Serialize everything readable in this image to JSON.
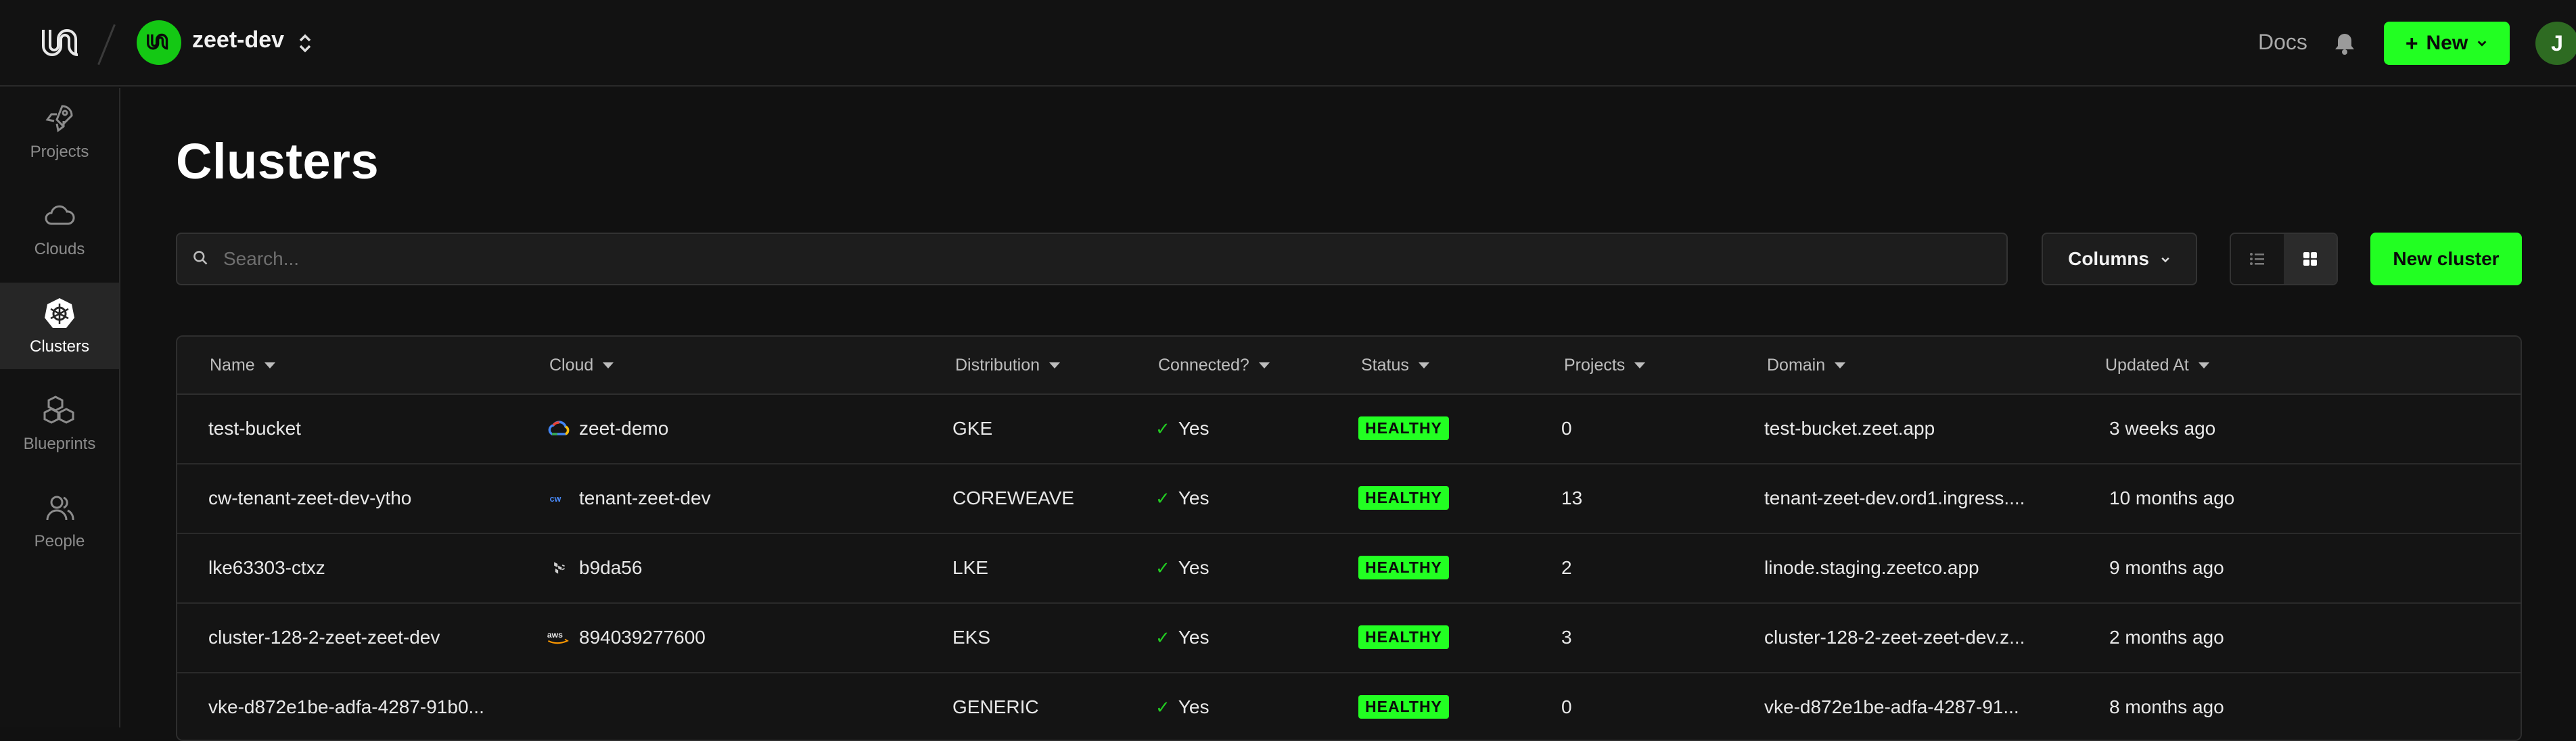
{
  "topbar": {
    "org_name": "zeet-dev",
    "docs_label": "Docs",
    "new_label": "New",
    "user_initial": "J"
  },
  "sidebar": {
    "items": [
      {
        "label": "Projects",
        "icon": "rocket-icon"
      },
      {
        "label": "Clouds",
        "icon": "cloud-icon"
      },
      {
        "label": "Clusters",
        "icon": "kubernetes-icon",
        "active": true
      },
      {
        "label": "Blueprints",
        "icon": "cubes-icon"
      },
      {
        "label": "People",
        "icon": "people-icon"
      }
    ]
  },
  "page": {
    "title": "Clusters",
    "search_placeholder": "Search...",
    "columns_label": "Columns",
    "new_cluster_label": "New cluster"
  },
  "table": {
    "headers": [
      "Name",
      "Cloud",
      "Distribution",
      "Connected?",
      "Status",
      "Projects",
      "Domain",
      "Updated At"
    ],
    "rows": [
      {
        "name": "test-bucket",
        "cloud_icon": "gcp-icon",
        "cloud": "zeet-demo",
        "distribution": "GKE",
        "connected": "Yes",
        "status": "HEALTHY",
        "projects": "0",
        "domain": "test-bucket.zeet.app",
        "updated": "3 weeks ago"
      },
      {
        "name": "cw-tenant-zeet-dev-ytho",
        "cloud_icon": "coreweave-icon",
        "cloud": "tenant-zeet-dev",
        "distribution": "COREWEAVE",
        "connected": "Yes",
        "status": "HEALTHY",
        "projects": "13",
        "domain": "tenant-zeet-dev.ord1.ingress....",
        "updated": "10 months ago"
      },
      {
        "name": "lke63303-ctxz",
        "cloud_icon": "linode-icon",
        "cloud": "b9da56",
        "distribution": "LKE",
        "connected": "Yes",
        "status": "HEALTHY",
        "projects": "2",
        "domain": "linode.staging.zeetco.app",
        "updated": "9 months ago"
      },
      {
        "name": "cluster-128-2-zeet-zeet-dev",
        "cloud_icon": "aws-icon",
        "cloud": "894039277600",
        "distribution": "EKS",
        "connected": "Yes",
        "status": "HEALTHY",
        "projects": "3",
        "domain": "cluster-128-2-zeet-zeet-dev.z...",
        "updated": "2 months ago"
      },
      {
        "name": "vke-d872e1be-adfa-4287-91b0...",
        "cloud_icon": "",
        "cloud": "",
        "distribution": "GENERIC",
        "connected": "Yes",
        "status": "HEALTHY",
        "projects": "0",
        "domain": "vke-d872e1be-adfa-4287-91...",
        "updated": "8 months ago"
      }
    ]
  },
  "colors": {
    "accent": "#22ff22",
    "background": "#111111",
    "border": "#2e2e2e"
  }
}
